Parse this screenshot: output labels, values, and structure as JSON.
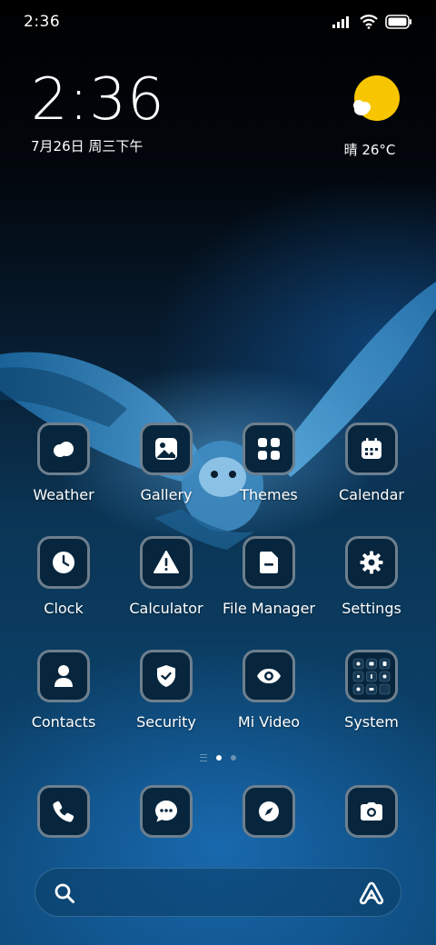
{
  "status_bar": {
    "time": "2:36",
    "icons": [
      "signal-icon",
      "wifi-icon",
      "battery-icon"
    ]
  },
  "clock_widget": {
    "time": "2:36",
    "date": "7月26日 周三下午"
  },
  "weather_widget": {
    "icon": "sun-cloud-icon",
    "text": "晴 26°C",
    "sun_color": "#f7c600"
  },
  "apps": [
    {
      "label": "Weather",
      "icon": "weather-icon"
    },
    {
      "label": "Gallery",
      "icon": "gallery-icon"
    },
    {
      "label": "Themes",
      "icon": "themes-icon"
    },
    {
      "label": "Calendar",
      "icon": "calendar-icon"
    },
    {
      "label": "Clock",
      "icon": "clock-icon"
    },
    {
      "label": "Calculator",
      "icon": "calculator-icon"
    },
    {
      "label": "File Manager",
      "icon": "file-manager-icon"
    },
    {
      "label": "Settings",
      "icon": "settings-icon"
    },
    {
      "label": "Contacts",
      "icon": "contacts-icon"
    },
    {
      "label": "Security",
      "icon": "security-icon"
    },
    {
      "label": "Mi Video",
      "icon": "mi-video-icon"
    },
    {
      "label": "System",
      "icon": "system-folder-icon"
    }
  ],
  "page_indicator": {
    "pages": 2,
    "current": 1
  },
  "dock": [
    {
      "icon": "phone-icon"
    },
    {
      "icon": "messages-icon"
    },
    {
      "icon": "browser-icon"
    },
    {
      "icon": "camera-icon"
    }
  ],
  "search_bar": {
    "left_icon": "search-icon",
    "right_icon": "assistant-icon"
  },
  "colors": {
    "icon_bg": "#07263d",
    "icon_border": "#6d7f8e",
    "accent": "#ffffff"
  }
}
